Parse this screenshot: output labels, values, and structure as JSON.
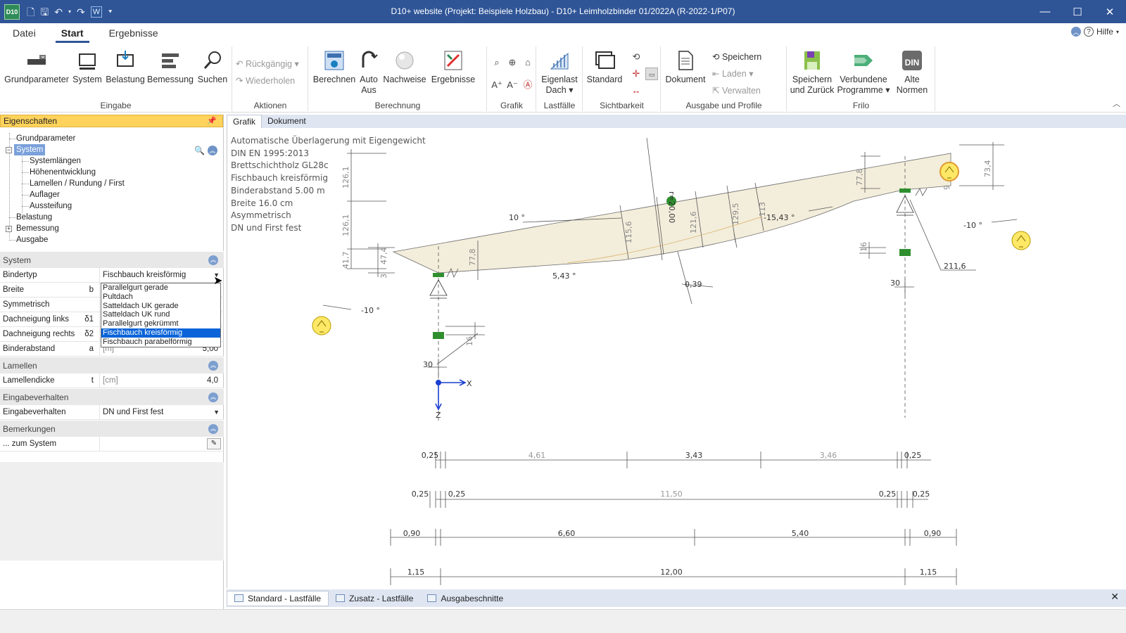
{
  "window": {
    "title": "D10+ website (Projekt: Beispiele Holzbau) - D10+ Leimholzbinder 01/2022A (R-2022-1/P07)",
    "logo": "D10",
    "controls": [
      "—",
      "☐",
      "✕"
    ]
  },
  "ribbon_tabs": [
    {
      "label": "Datei"
    },
    {
      "label": "Start"
    },
    {
      "label": "Ergebnisse"
    }
  ],
  "help_label": "Hilfe",
  "ribbon": {
    "eingabe": {
      "label": "Eingabe",
      "buttons": [
        "Grundparameter",
        "System",
        "Belastung",
        "Bemessung",
        "Suchen"
      ]
    },
    "aktionen": {
      "label": "Aktionen",
      "undo": "Rückgängig",
      "redo": "Wiederholen"
    },
    "berechnung": {
      "label": "Berechnung",
      "buttons": [
        "Berechnen",
        "Auto",
        "Aus",
        "Nachweise",
        "Ergebnisse"
      ]
    },
    "grafik": {
      "label": "Grafik"
    },
    "lastfaelle": {
      "label": "Lastfälle",
      "eigenlast_1": "Eigenlast",
      "eigenlast_2": "Dach"
    },
    "sichtbarkeit": {
      "label": "Sichtbarkeit",
      "standard": "Standard"
    },
    "ausgabe": {
      "label": "Ausgabe und Profile",
      "dokument": "Dokument",
      "speichern": "Speichern",
      "laden": "Laden",
      "verwalten": "Verwalten"
    },
    "frilo": {
      "label": "Frilo",
      "speichern_1": "Speichern",
      "speichern_2": "und Zurück",
      "verbundene_1": "Verbundene",
      "verbundene_2": "Programme",
      "alte_1": "Alte",
      "alte_2": "Normen",
      "din": "DIN"
    }
  },
  "properties_panel": {
    "title": "Eigenschaften",
    "tree": [
      {
        "label": "Grundparameter"
      },
      {
        "label": "System"
      },
      {
        "label": "Systemlängen"
      },
      {
        "label": "Höhenentwicklung"
      },
      {
        "label": "Lamellen / Rundung / First"
      },
      {
        "label": "Auflager"
      },
      {
        "label": "Aussteifung"
      },
      {
        "label": "Belastung"
      },
      {
        "label": "Bemessung"
      },
      {
        "label": "Ausgabe"
      }
    ],
    "sections": {
      "system": {
        "title": "System",
        "rows": [
          {
            "label": "Bindertyp",
            "symbol": "",
            "value": "Fischbauch kreisförmig"
          },
          {
            "label": "Breite",
            "symbol": "b",
            "value": ""
          },
          {
            "label": "Symmetrisch",
            "symbol": "",
            "value": ""
          },
          {
            "label": "Dachneigung links",
            "symbol": "δ1",
            "value": ""
          },
          {
            "label": "Dachneigung rechts",
            "symbol": "δ2",
            "value": ""
          },
          {
            "label": "Binderabstand",
            "symbol": "a",
            "unit": "[m]",
            "value": "5,00"
          }
        ]
      },
      "lamellen": {
        "title": "Lamellen",
        "rows": [
          {
            "label": "Lamellendicke",
            "symbol": "t",
            "unit": "[cm]",
            "value": "4,0"
          }
        ]
      },
      "eingabeverhalten": {
        "title": "Eingabeverhalten",
        "rows": [
          {
            "label": "Eingabeverhalten",
            "value": "DN und First fest"
          }
        ]
      },
      "bemerkungen": {
        "title": "Bemerkungen",
        "rows": [
          {
            "label": "... zum System",
            "value": ""
          }
        ]
      }
    },
    "bindertyp_options": [
      "Parallelgurt gerade",
      "Pultdach",
      "Satteldach UK gerade",
      "Satteldach UK rund",
      "Parallelgurt gekrümmt",
      "Fischbauch kreisförmig",
      "Fischbauch parabelförmig"
    ],
    "bindertyp_selected_index": 5
  },
  "document_tabs": [
    {
      "label": "Grafik"
    },
    {
      "label": "Dokument"
    }
  ],
  "drawing": {
    "info_lines": [
      "Automatische Überlagerung mit Eigengewicht",
      "DIN EN 1995:2013",
      "Brettschichtholz GL28c",
      "Fischbauch kreisförmig",
      "Binderabstand 5.00 m",
      "Breite 16.0 cm",
      "Asymmetrisch",
      "DN und First fest"
    ],
    "labels": {
      "angle_left_top": "10 °",
      "angle_left_bottom": "5,43 °",
      "angle_right": "-15,43 °",
      "angle_left_ext": "-10 °",
      "angle_right_ext": "-10 °",
      "radius": "r=20,00",
      "dim_211": "211,6",
      "dim_0_39": "0,39",
      "h_126_a": "126,1",
      "h_126_b": "126,1",
      "h_41": "41,7",
      "h_47": "47,4",
      "h_3": "3",
      "h_77_left": "77,8",
      "h_77_right": "77,8",
      "h_73": "73,4",
      "h_115": "115,6",
      "h_121": "121,6",
      "h_129": "129,5",
      "h_113": "113",
      "h_9": "9",
      "h_16_left": "16",
      "h_16_right": "16",
      "w_30_left": "30",
      "w_30_right": "30",
      "axis_x": "X",
      "axis_z": "Z"
    },
    "dim_rows": [
      [
        "0,25",
        "4,61",
        "3,43",
        "3,46",
        "0,25"
      ],
      [
        "0,25",
        "0,25",
        "11,50",
        "0,25",
        "0,25"
      ],
      [
        "0,90",
        "6,60",
        "5,40",
        "0,90"
      ],
      [
        "1,15",
        "12,00",
        "1,15"
      ]
    ]
  },
  "bottom_tabs": [
    {
      "label": "Standard - Lastfälle"
    },
    {
      "label": "Zusatz - Lastfälle"
    },
    {
      "label": "Ausgabeschnitte"
    }
  ],
  "colors": {
    "titlebar": "#2f5597",
    "beam_fill": "#f3eddb",
    "support": "#2f8f2f",
    "accent": "#0a64d8"
  }
}
